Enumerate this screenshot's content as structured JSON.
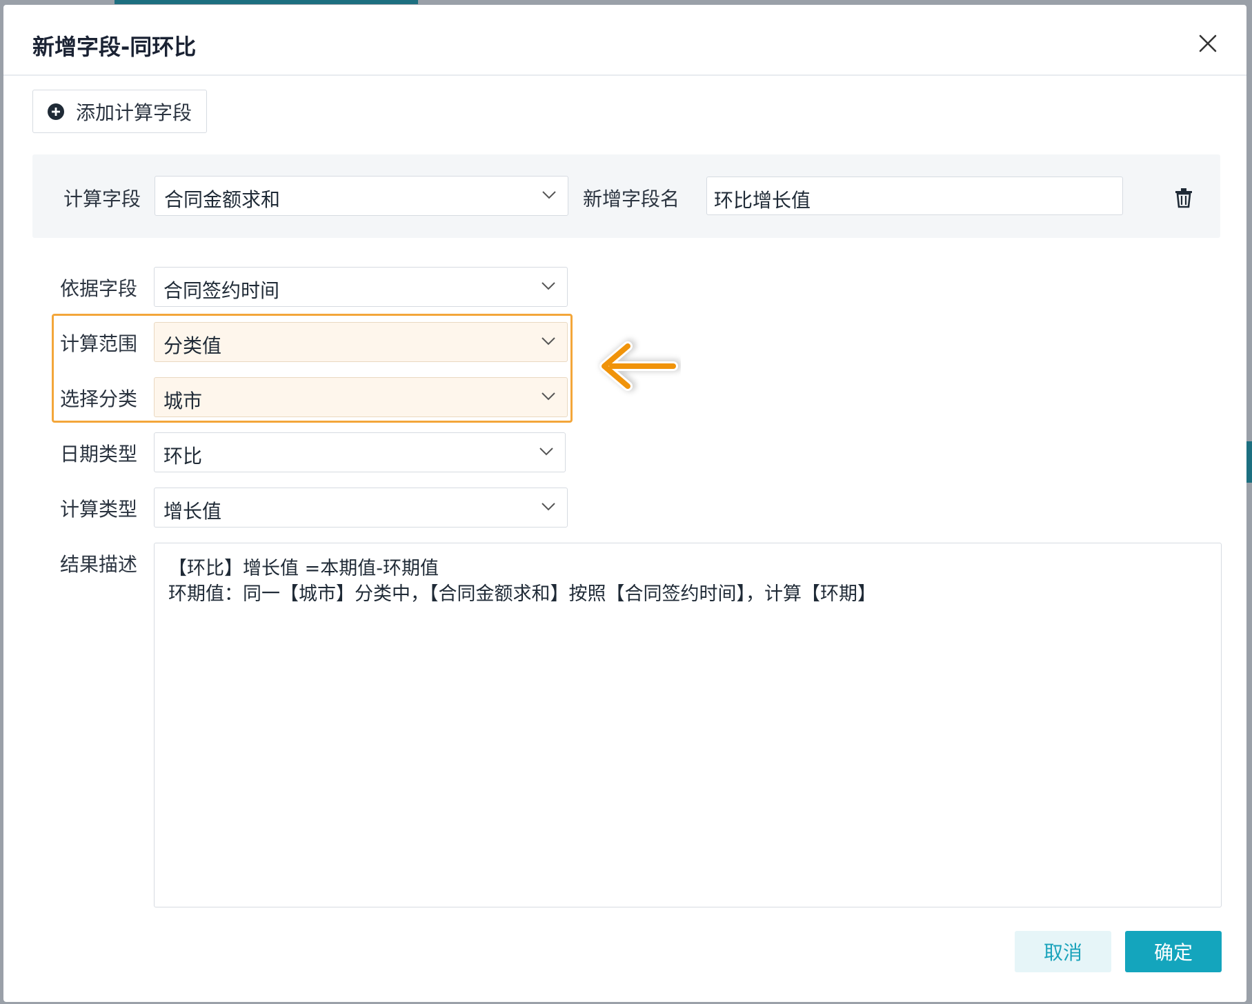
{
  "dialog": {
    "title": "新增字段-同环比",
    "close_icon": "close-icon"
  },
  "toolbar": {
    "add_calc_field_label": "添加计算字段",
    "add_icon": "plus-circle-icon"
  },
  "calc_row": {
    "calc_field_label": "计算字段",
    "calc_field_value": "合同金额求和",
    "new_field_name_label": "新增字段名",
    "new_field_name_value": "环比增长值",
    "delete_icon": "trash-icon"
  },
  "form": {
    "basis_field_label": "依据字段",
    "basis_field_value": "合同签约时间",
    "calc_range_label": "计算范围",
    "calc_range_value": "分类值",
    "select_category_label": "选择分类",
    "select_category_value": "城市",
    "date_type_label": "日期类型",
    "date_type_value": "环比",
    "calc_type_label": "计算类型",
    "calc_type_value": "增长值",
    "result_desc_label": "结果描述",
    "result_desc_lines": [
      "【环比】增长值 =本期值-环期值",
      "环期值：同一【城市】分类中，【合同金额求和】按照【合同签约时间】，计算【环期】"
    ]
  },
  "annotation": {
    "highlight_color": "#f3a63a",
    "arrow_icon": "arrow-left-icon"
  },
  "footer": {
    "cancel_label": "取消",
    "confirm_label": "确定"
  },
  "colors": {
    "primary": "#14a5bd",
    "primary_light": "#e6f5f8",
    "highlight_fill": "#fef6ec"
  }
}
